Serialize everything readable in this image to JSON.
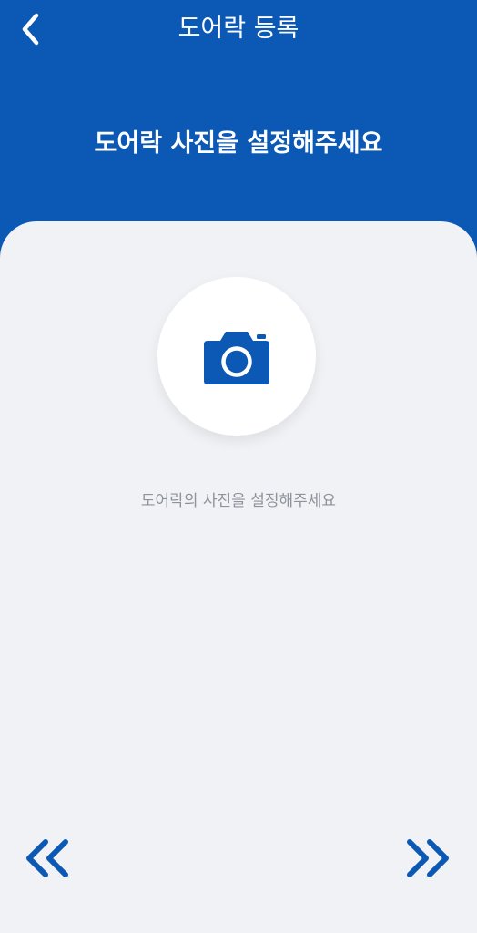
{
  "header": {
    "title": "도어락 등록",
    "heading": "도어락 사진을 설정해주세요",
    "back_icon": "chevron-left-icon"
  },
  "photo": {
    "icon": "camera-icon",
    "hint": "도어락의 사진을 설정해주세요"
  },
  "navigation": {
    "prev_icon": "double-chevron-left-icon",
    "next_icon": "double-chevron-right-icon"
  },
  "colors": {
    "brand": "#0b58b5",
    "background": "#f0f2f5",
    "hint_text": "#8e939b",
    "white": "#ffffff"
  }
}
